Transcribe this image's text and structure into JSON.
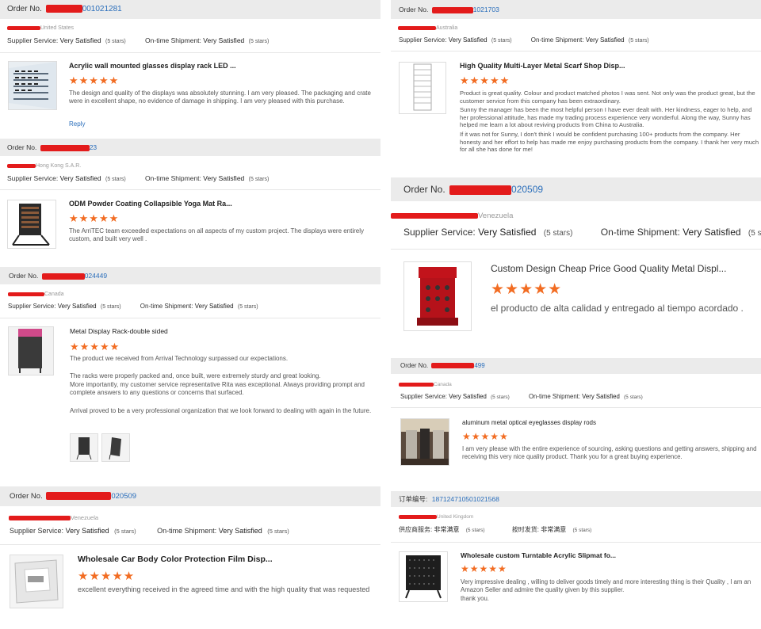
{
  "colors": {
    "accent_link": "#2a6ebb",
    "star": "#f26c22",
    "redaction": "#e31b1b",
    "bar_bg": "#ebebeb"
  },
  "star_icon": "★★★★★",
  "left": [
    {
      "order_label": "Order No.",
      "order_visible": "001021281",
      "country": "United States",
      "supplier_label": "Supplier Service:",
      "supplier_value": "Very Satisfied",
      "supplier_stars": "(5 stars)",
      "ontime_label": "On-time Shipment:",
      "ontime_value": "Very Satisfied",
      "ontime_stars": "(5 stars)",
      "product": "Acrylic wall mounted glasses display rack LED ...",
      "rating": 5,
      "review": "The design and quality of the displays was absolutely stunning.  I am very pleased.  The packaging and crate were in excellent shape, no evidence of damage in shipping.  I am very pleased with this purchase.",
      "reply": "Reply"
    },
    {
      "order_label": "Order No.",
      "order_visible": "23",
      "country": "Hong Kong S.A.R.",
      "supplier_label": "Supplier Service:",
      "supplier_value": "Very Satisfied",
      "supplier_stars": "(5 stars)",
      "ontime_label": "On-time Shipment:",
      "ontime_value": "Very Satisfied",
      "ontime_stars": "(5 stars)",
      "product": "ODM Powder Coating Collapsible Yoga Mat Ra...",
      "rating": 5,
      "review": "The ArriTEC team exceeded expectations on all aspects of my custom project. The displays were entirely custom, and built very well ."
    },
    {
      "order_label": "Order No.",
      "order_visible": "024449",
      "country": "Canada",
      "supplier_label": "Supplier Service:",
      "supplier_value": "Very Satisfied",
      "supplier_stars": "(5 stars)",
      "ontime_label": "On-time Shipment:",
      "ontime_value": "Very Satisfied",
      "ontime_stars": "(5 stars)",
      "product": "Metal Display Rack-double sided",
      "rating": 5,
      "review_p1": "The product we received from Arrival Technology surpassed our expectations.",
      "review_p2": "The racks were properly packed and, once built, were extremely sturdy and great looking.",
      "review_p3": "More importantly, my customer service representative Rita was exceptional.  Always providing prompt and complete answers to any questions or concerns that surfaced.",
      "review_p4": "Arrival proved to be a very professional organization that we look forward to dealing with again in the future."
    },
    {
      "order_label": "Order No.",
      "order_visible": "020509",
      "country": "Venezuela",
      "supplier_label": "Supplier Service:",
      "supplier_value": "Very Satisfied",
      "supplier_stars": "(5 stars)",
      "ontime_label": "On-time Shipment:",
      "ontime_value": "Very Satisfied",
      "ontime_stars": "(5 stars)",
      "product": "Wholesale Car Body Color Protection Film Disp...",
      "rating": 5,
      "review": "excellent everything received in the agreed time and with the high quality that was requested"
    }
  ],
  "right": [
    {
      "order_label": "Order No.",
      "order_visible": "1021703",
      "country": "Australia",
      "supplier_label": "Supplier Service:",
      "supplier_value": "Very Satisfied",
      "supplier_stars": "(5 stars)",
      "ontime_label": "On-time Shipment:",
      "ontime_value": "Very Satisfied",
      "ontime_stars": "(5 stars)",
      "product": "High Quality Multi-Layer Metal Scarf Shop Disp...",
      "rating": 5,
      "review_l1": "Product is great quality. Colour and product matched photos I was sent. Not only was the product great, but the customer service from this company has been extraordinary.",
      "review_l2": "Sunny the manager  has been the most helpful person I have ever dealt with. Her kindness, eager to help, and her professional attitude, has made my trading process experience very wonderful. Along the way, Sunny has helped me learn a lot about reviving  products from China to Australia.",
      "review_l3": "If it was not for Sunny, I don't think I would be confident purchasing 100+ products from the company. Her honesty and her effort to help has made me enjoy purchasing products  from the company. I thank her very much for all she has done for me!"
    },
    {
      "order_label": "Order No.",
      "order_visible": "020509",
      "country": "Venezuela",
      "supplier_label": "Supplier Service:",
      "supplier_value": "Very Satisfied",
      "supplier_stars": "(5 stars)",
      "ontime_label": "On-time Shipment:",
      "ontime_value": "Very Satisfied",
      "ontime_stars": "(5 stars)",
      "product": "Custom Design Cheap Price Good Quality Metal Displ...",
      "rating": 5,
      "review": "el producto de alta calidad y entregado al tiempo acordado ."
    },
    {
      "order_label": "Order No.",
      "order_visible": "499",
      "country": "Canada",
      "supplier_label": "Supplier Service:",
      "supplier_value": "Very Satisfied",
      "supplier_stars": "(5 stars)",
      "ontime_label": "On-time Shipment:",
      "ontime_value": "Very Satisfied",
      "ontime_stars": "(5 stars)",
      "product": "aluminum metal optical eyeglasses display rods",
      "rating": 5,
      "review": "I am very please with the entire experience of sourcing, asking questions and getting answers, shipping and receiving this very nice quality product.  Thank you for a great buying experience."
    },
    {
      "order_label": "订单编号:",
      "order_visible": "187124710501021568",
      "country": "United Kingdom",
      "supplier_label": "供应商服务:",
      "supplier_value": "非常满意",
      "supplier_stars": "(5 stars)",
      "ontime_label": "按时发货:",
      "ontime_value": "非常满意",
      "ontime_stars": "(5 stars)",
      "product": "Wholesale custom Turntable Acrylic Slipmat fo...",
      "rating": 5,
      "review_l1": "Very impressive dealing , willing to deliver goods timely and more interesting thing is their Quality , I am an Amazon Seller and admire the quality given by this supplier.",
      "review_l2": "thank you."
    }
  ]
}
